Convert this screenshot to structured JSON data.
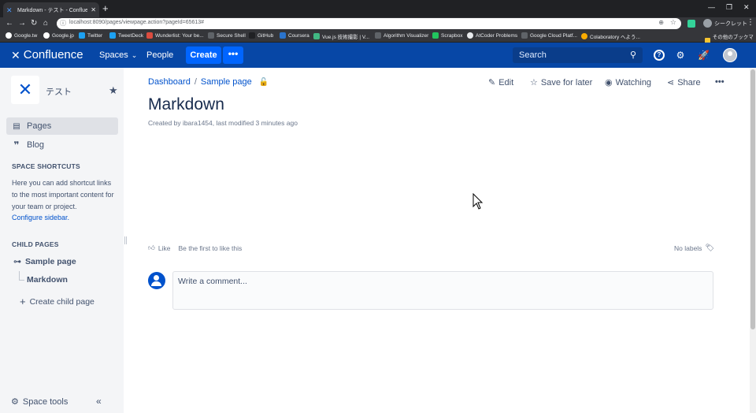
{
  "browser": {
    "tab_title": "Markdown - テスト - Confluence",
    "url": "localhost:8090/pages/viewpage.action?pageId=65613#",
    "profile_label": "シークレット",
    "bookmarks": [
      "Google.tw",
      "Google.jp",
      "Twitter",
      "TweetDeck",
      "Wunderlist: Your be...",
      "Secure Shell",
      "GitHub",
      "Coursera",
      "Vue.js 技術撮影 | V...",
      "Algorithm Visualizer",
      "Scrapbox",
      "AtCoder Problems",
      "Google Cloud Platf...",
      "Colaboratory へよう..."
    ],
    "other_bookmarks": "その他のブックマーク"
  },
  "header": {
    "product_name": "Confluence",
    "spaces_label": "Spaces",
    "people_label": "People",
    "create_label": "Create",
    "more_label": "•••",
    "search_placeholder": "Search"
  },
  "sidebar": {
    "space_name": "テスト",
    "pages_label": "Pages",
    "blog_label": "Blog",
    "shortcuts_heading": "SPACE SHORTCUTS",
    "shortcuts_text": "Here you can add shortcut links to the most important content for your team or project.",
    "configure_link": "Configure sidebar.",
    "child_pages_heading": "CHILD PAGES",
    "parent_page": "Sample page",
    "child_page": "Markdown",
    "create_child": "Create child page",
    "space_tools": "Space tools"
  },
  "page": {
    "breadcrumb": [
      "Dashboard",
      "Sample page"
    ],
    "actions": {
      "edit": "Edit",
      "save_for_later": "Save for later",
      "watching": "Watching",
      "share": "Share"
    },
    "title": "Markdown",
    "meta": "Created by ibara1454, last modified 3 minutes ago",
    "like_label": "Like",
    "like_prompt": "Be the first to like this",
    "labels_text": "No labels",
    "comment_placeholder": "Write a comment..."
  }
}
